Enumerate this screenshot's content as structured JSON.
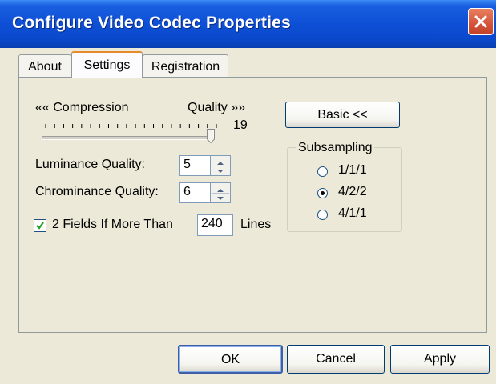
{
  "window": {
    "title": "Configure Video Codec Properties"
  },
  "tabs": [
    {
      "label": "About",
      "selected": false
    },
    {
      "label": "Settings",
      "selected": true
    },
    {
      "label": "Registration",
      "selected": false
    }
  ],
  "settings": {
    "slider": {
      "left_label": "«« Compression",
      "right_label": "Quality »»",
      "value": 19
    },
    "luminance_label": "Luminance Quality:",
    "luminance_value": "5",
    "chrominance_label": "Chrominance Quality:",
    "chrominance_value": "6",
    "fields_checkbox": {
      "checked": true,
      "label": "2 Fields If More Than",
      "value": "240",
      "suffix": "Lines"
    },
    "basic_button": "Basic <<",
    "subsampling": {
      "title": "Subsampling",
      "options": [
        {
          "label": "1/1/1",
          "selected": false
        },
        {
          "label": "4/2/2",
          "selected": true
        },
        {
          "label": "4/1/1",
          "selected": false
        }
      ]
    }
  },
  "buttons": {
    "ok": "OK",
    "cancel": "Cancel",
    "apply": "Apply"
  },
  "icons": {
    "close": "close-icon",
    "check": "checkmark-icon",
    "spin_up": "arrow-up-icon",
    "spin_down": "arrow-down-icon"
  },
  "colors": {
    "titlebar": "#0a48c9",
    "close_button": "#d4533a",
    "dialog_bg": "#ece9d8",
    "tab_highlight": "#e68b2c"
  }
}
